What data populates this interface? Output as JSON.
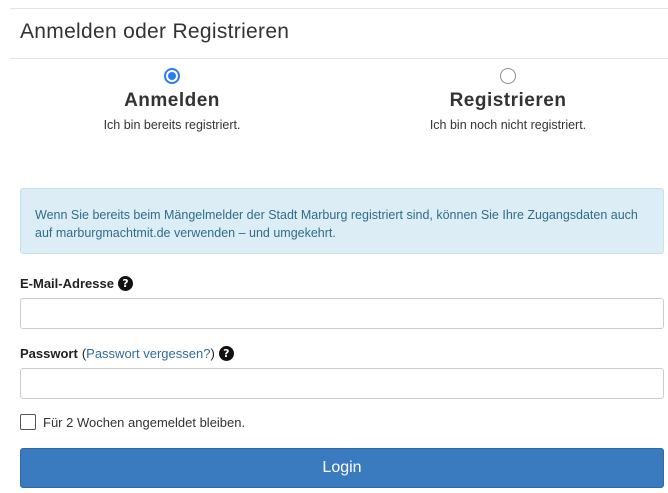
{
  "header": {
    "title": "Anmelden oder Registrieren"
  },
  "choices": {
    "login": {
      "title": "Anmelden",
      "subtitle": "Ich bin bereits registriert.",
      "selected": true
    },
    "register": {
      "title": "Registrieren",
      "subtitle": "Ich bin noch nicht registriert.",
      "selected": false
    }
  },
  "info": {
    "text": "Wenn Sie bereits beim Mängelmelder der Stadt Marburg registriert sind, können Sie Ihre Zugangsdaten auch auf marburgmachtmit.de verwenden – und umgekehrt."
  },
  "form": {
    "email_label": "E-Mail-Adresse",
    "email_value": "",
    "password_label": "Passwort",
    "forgot_open": "(",
    "forgot_link": "Passwort vergessen?",
    "forgot_close": ")",
    "password_value": "",
    "help_icon": "question-circle-icon",
    "remember_label": "Für 2 Wochen angemeldet bleiben.",
    "remember_checked": false,
    "submit_label": "Login"
  },
  "colors": {
    "accent": "#2b7de9",
    "button": "#3a7bbf",
    "info_bg": "#dcedf5",
    "info_text": "#2f6d8a",
    "link": "#2f6d9e"
  }
}
